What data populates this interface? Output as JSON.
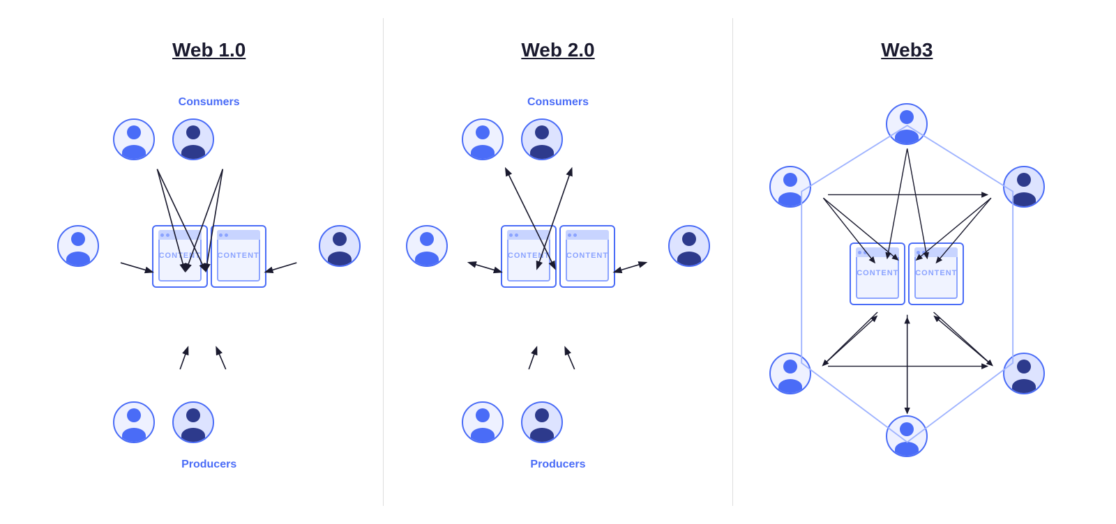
{
  "sections": [
    {
      "id": "web1",
      "title": "Web 1.0",
      "consumers_label": "Consumers",
      "producers_label": "Producers",
      "content_label": "CONTENT"
    },
    {
      "id": "web2",
      "title": "Web 2.0",
      "consumers_label": "Consumers",
      "producers_label": "Producers",
      "content_label": "CONTENT"
    },
    {
      "id": "web3",
      "title": "Web3",
      "content_label": "CONTENT"
    }
  ],
  "colors": {
    "blue": "#4a6cf7",
    "dark_blue": "#2d3a8c",
    "light_blue": "#eef1ff",
    "border": "#dddddd"
  }
}
